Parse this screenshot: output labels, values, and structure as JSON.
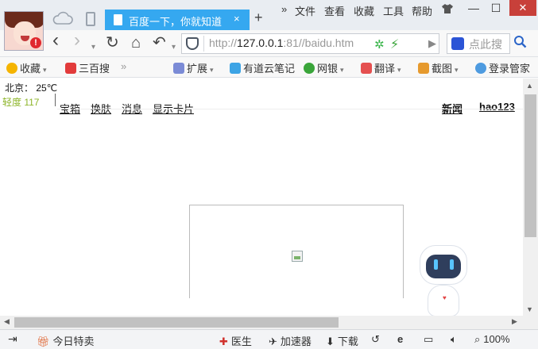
{
  "colors": {
    "accent_tab": "#35a8f0",
    "close_red": "#c8403a",
    "aqi_green": "#8db52a",
    "link": "#111111"
  },
  "tabbar": {
    "active_tab_title": "百度一下，你就知道",
    "tab_close": "×",
    "new_tab": "+",
    "menu": {
      "more": "»",
      "file": "文件",
      "view": "查看",
      "favorites": "收藏",
      "tools": "工具",
      "help": "帮助"
    },
    "window_buttons": {
      "minimize": "—",
      "maximize": "☐",
      "close": "✕"
    },
    "avatar_badge": "!"
  },
  "navbar": {
    "back": "‹",
    "forward": "›",
    "dropdown": "▾",
    "refresh": "↻",
    "home": "⌂",
    "undo": "↶",
    "url_prefix": "http://",
    "url_host": "127.0.0.1",
    "url_rest": ":81//baidu.htm",
    "search_placeholder": "点此搜",
    "search_icon": "search-icon"
  },
  "bookmarks": [
    {
      "label": "收藏",
      "icon": "star-icon"
    },
    {
      "label": "三百搜",
      "icon": "sanbaisou-icon"
    },
    {
      "label": "扩展",
      "icon": "extensions-icon"
    },
    {
      "label": "有道云笔记",
      "icon": "youdao-icon"
    },
    {
      "label": "网银",
      "icon": "bank-icon"
    },
    {
      "label": "翻译",
      "icon": "translate-icon"
    },
    {
      "label": "截图",
      "icon": "screenshot-icon"
    },
    {
      "label": "登录管家",
      "icon": "login-manager-icon"
    }
  ],
  "page": {
    "weather": "北京：  25℃",
    "aqi": "轻度  117",
    "links_left": [
      "宝箱",
      "换肤",
      "消息",
      "显示卡片"
    ],
    "links_right": [
      "新闻",
      "hao123"
    ]
  },
  "statusbar": {
    "daily_deals": "今日特卖",
    "doctor": "医生",
    "accelerator": "加速器",
    "download": "下载",
    "zoom": "100%"
  }
}
